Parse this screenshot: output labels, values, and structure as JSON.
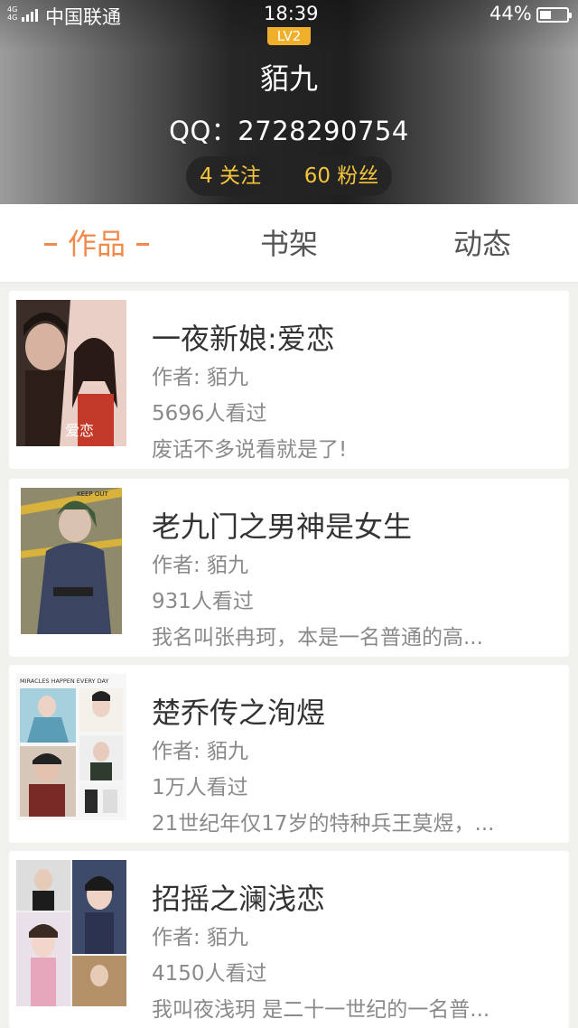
{
  "status_bar": {
    "network": "4G 4G",
    "carrier": "中国联通",
    "time": "18:39",
    "battery_percent": "44%"
  },
  "profile": {
    "level": "LV2",
    "name": "貊九",
    "qq": "QQ：2728290754",
    "follow": "4 关注",
    "fans": "60 粉丝"
  },
  "tabs": {
    "works": "作品",
    "shelf": "书架",
    "activity": "动态"
  },
  "books": [
    {
      "title": "一夜新娘:爱恋",
      "author": "作者: 貊九",
      "views": "5696人看过",
      "desc": "废话不多说看就是了!",
      "cover_text": "爱恋"
    },
    {
      "title": "老九门之男神是女生",
      "author": "作者: 貊九",
      "views": "931人看过",
      "desc": "我名叫张冉珂，本是一名普通的高...",
      "cover_text": "KEEP OUT"
    },
    {
      "title": "楚乔传之洵煜",
      "author": "作者: 貊九",
      "views": "1万人看过",
      "desc": "21世纪年仅17岁的特种兵王莫煜，...",
      "cover_text": "MIRACLES HAPPEN EVERY DAY"
    },
    {
      "title": "招摇之澜浅恋",
      "author": "作者: 貊九",
      "views": "4150人看过",
      "desc": "我叫夜浅玥 是二十一世纪的一名普..."
    }
  ],
  "colors": {
    "accent": "#f08a4b",
    "stat_text": "#f4c43a",
    "level_badge": "#f1b02a"
  }
}
